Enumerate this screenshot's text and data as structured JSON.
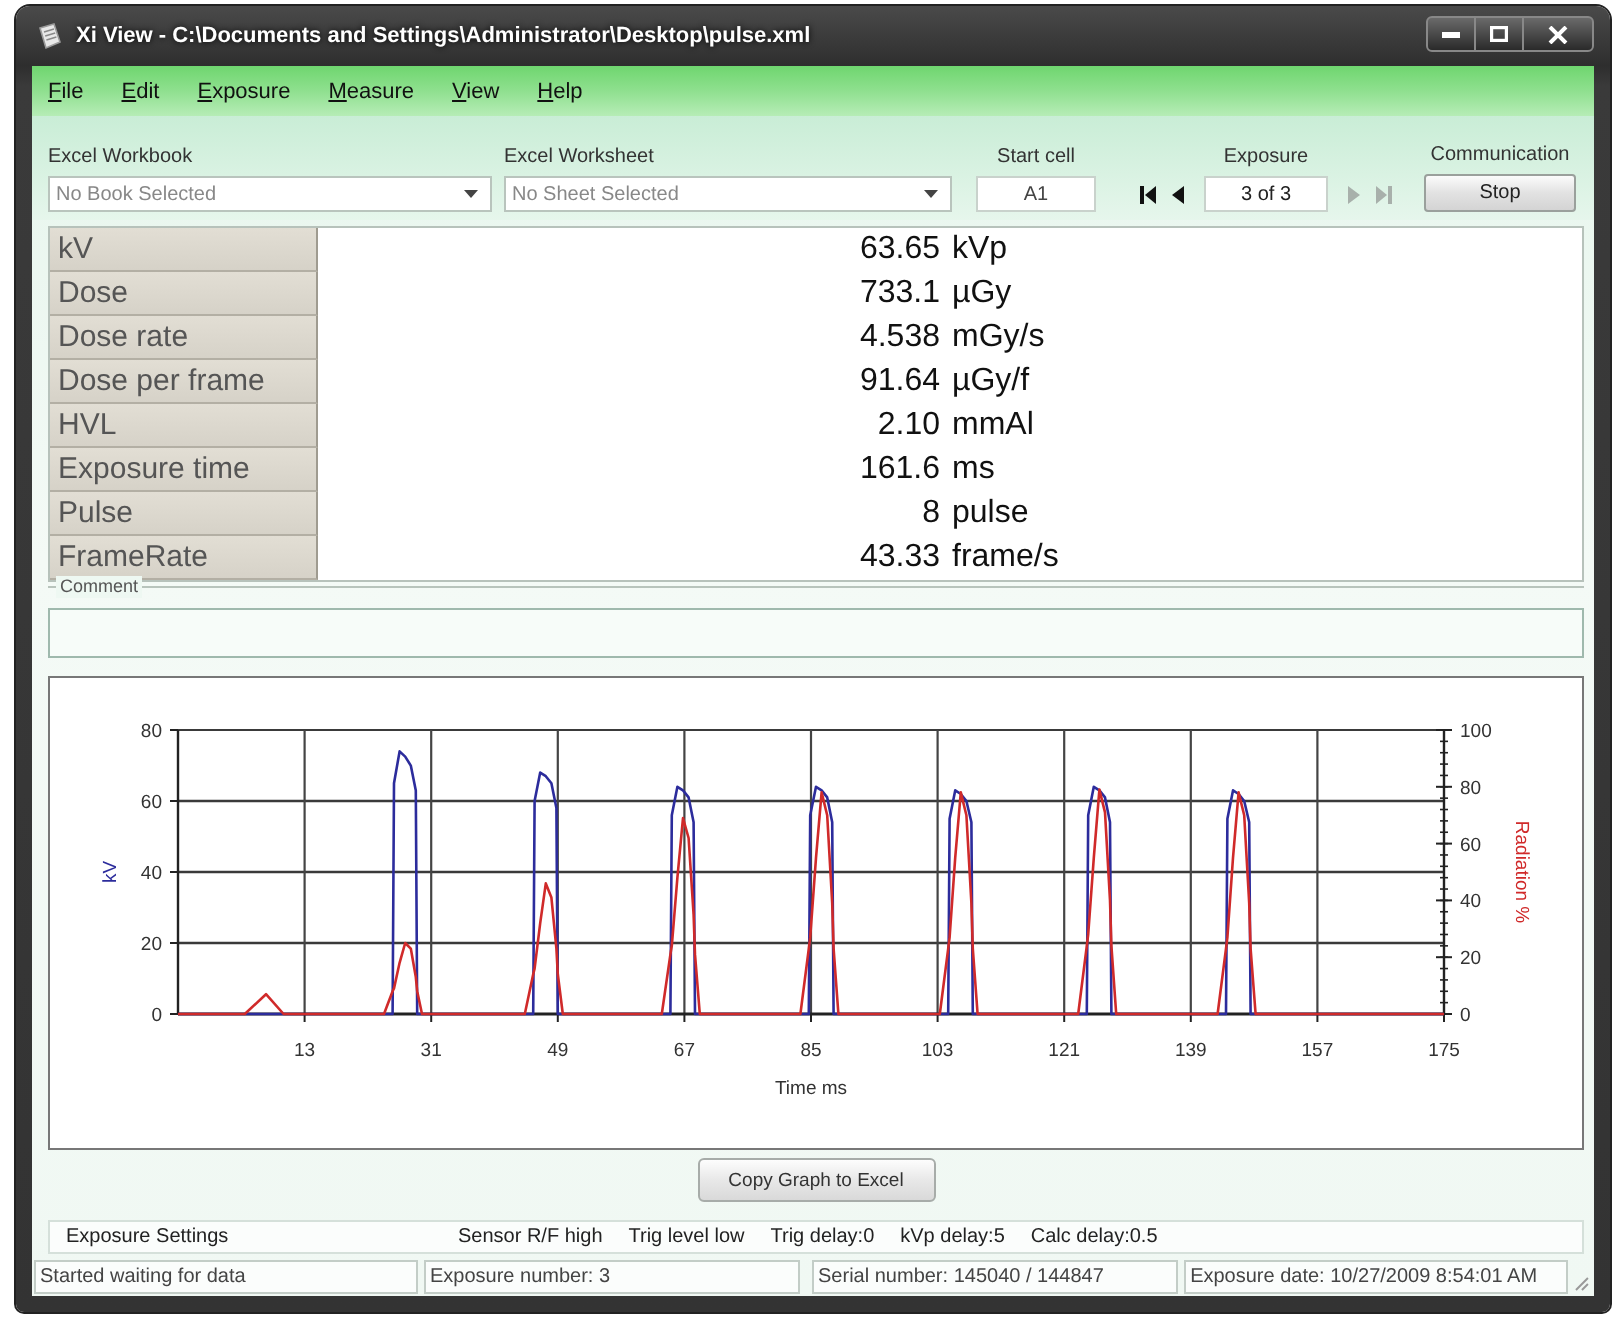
{
  "window": {
    "title": "Xi View - C:\\Documents and Settings\\Administrator\\Desktop\\pulse.xml"
  },
  "menu": [
    "File",
    "Edit",
    "Exposure",
    "Measure",
    "View",
    "Help"
  ],
  "toolbar": {
    "workbook": {
      "label": "Excel Workbook",
      "value": "No Book Selected"
    },
    "worksheet": {
      "label": "Excel Worksheet",
      "value": "No Sheet Selected"
    },
    "start_cell": {
      "label": "Start cell",
      "value": "A1"
    },
    "exposure": {
      "label": "Exposure",
      "value": "3 of 3",
      "nav": [
        {
          "kind": "first",
          "disabled": false
        },
        {
          "kind": "previous",
          "disabled": false
        },
        {
          "kind": "next",
          "disabled": true
        },
        {
          "kind": "last",
          "disabled": true
        }
      ]
    },
    "communication": {
      "label": "Communication",
      "button": "Stop"
    }
  },
  "measurements": [
    {
      "name": "kV",
      "value": "63.65",
      "unit": "kVp"
    },
    {
      "name": "Dose",
      "value": "733.1",
      "unit": "µGy"
    },
    {
      "name": "Dose rate",
      "value": "4.538",
      "unit": "mGy/s"
    },
    {
      "name": "Dose per frame",
      "value": "91.64",
      "unit": "µGy/f"
    },
    {
      "name": "HVL",
      "value": "2.10",
      "unit": "mmAl"
    },
    {
      "name": "Exposure time",
      "value": "161.6",
      "unit": "ms"
    },
    {
      "name": "Pulse",
      "value": "8",
      "unit": "pulse"
    },
    {
      "name": "FrameRate",
      "value": "43.33",
      "unit": "frame/s"
    }
  ],
  "comment": {
    "label": "Comment"
  },
  "graph": {
    "chart_data": {
      "type": "line",
      "xlabel": "Time ms",
      "x": [
        -5,
        4.5,
        7.5,
        10,
        24.3,
        25.5,
        25.7,
        26.5,
        27.3,
        28.1,
        28.8,
        29.0,
        29.7,
        44.3,
        45.5,
        45.7,
        46.5,
        47.3,
        48.1,
        48.8,
        49.0,
        49.7,
        63.8,
        65.0,
        65.2,
        66.0,
        66.8,
        67.6,
        68.3,
        68.5,
        69.2,
        83.5,
        84.7,
        84.9,
        85.7,
        86.5,
        87.3,
        88.0,
        88.2,
        88.9,
        103.3,
        104.5,
        104.7,
        105.5,
        106.3,
        107.1,
        107.8,
        108.0,
        108.7,
        123.0,
        124.2,
        124.4,
        125.2,
        126.0,
        126.8,
        127.5,
        127.7,
        128.4,
        142.8,
        144.0,
        144.2,
        145.0,
        145.8,
        146.6,
        147.3,
        147.5,
        148.2,
        175
      ],
      "series": [
        {
          "name": "kV",
          "color": "#2c2c9c",
          "values": [
            0,
            0,
            0,
            0,
            0,
            0,
            65,
            74,
            72.5,
            70,
            63,
            0,
            0,
            0,
            0,
            60,
            68,
            67,
            65,
            58,
            0,
            0,
            0,
            0,
            56,
            64,
            63,
            61,
            54,
            0,
            0,
            0,
            0,
            56,
            64,
            63,
            61,
            54,
            0,
            0,
            0,
            0,
            55,
            63,
            62,
            60,
            54,
            0,
            0,
            0,
            0,
            56,
            64,
            63,
            61,
            54,
            0,
            0,
            0,
            0,
            55,
            63,
            62,
            60,
            54,
            0,
            0,
            0
          ]
        },
        {
          "name": "Radiation %",
          "axis": "y2",
          "color": "#d02a2a",
          "values": [
            0,
            0,
            7,
            0,
            0,
            8,
            9,
            18,
            25,
            23,
            13,
            8,
            0,
            0,
            14,
            16,
            32,
            46,
            41,
            23,
            14,
            0,
            0,
            21,
            24,
            48,
            69,
            62,
            35,
            21,
            0,
            0,
            23,
            27,
            55,
            78,
            70,
            39,
            23,
            0,
            0,
            23,
            27,
            55,
            78,
            70,
            39,
            23,
            0,
            0,
            24,
            28,
            55,
            79,
            71,
            40,
            24,
            0,
            0,
            23,
            27,
            55,
            78,
            70,
            39,
            23,
            0,
            0
          ]
        }
      ],
      "xlim": [
        -5,
        175
      ],
      "ylim": [
        0,
        80
      ],
      "y2lim": [
        0,
        100
      ],
      "xticks": [
        13,
        31,
        49,
        67,
        85,
        103,
        121,
        139,
        157,
        175
      ],
      "yticks": [
        0,
        20,
        40,
        60,
        80
      ],
      "y2ticks": [
        0,
        20,
        40,
        60,
        80,
        100
      ],
      "grid": true
    }
  },
  "copy_button": "Copy Graph to Excel",
  "exposure_settings": {
    "title": "Exposure Settings",
    "items": [
      "Sensor R/F high",
      "Trig level low",
      "Trig delay:0",
      "kVp delay:5",
      "Calc delay:0.5"
    ]
  },
  "status_bar": [
    "Started waiting for data",
    "Exposure number: 3",
    "Serial number: 145040 / 144847",
    "Exposure date: 10/27/2009 8:54:01 AM"
  ]
}
